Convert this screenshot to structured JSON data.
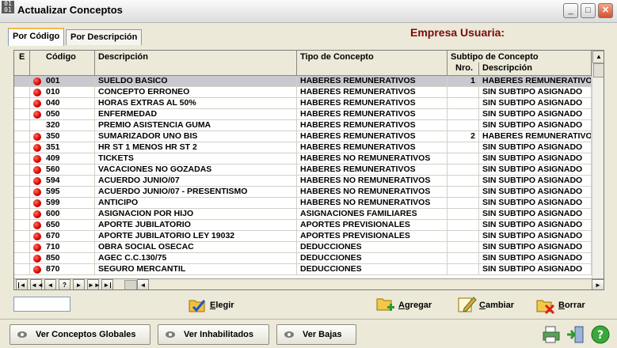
{
  "window": {
    "title": "Actualizar Conceptos",
    "app_icon_text": "01 01",
    "minimize_label": "_",
    "maximize_label": "□",
    "close_label": "✕"
  },
  "tabs": [
    {
      "label": "Por Código",
      "active": true
    },
    {
      "label": "Por Descripción",
      "active": false
    }
  ],
  "empresa_label": "Empresa Usuaria:",
  "grid": {
    "columns": {
      "e": "E",
      "codigo": "Código",
      "descripcion": "Descripción",
      "tipo": "Tipo de Concepto",
      "subtipo": "Subtipo de Concepto",
      "nro": "Nro.",
      "sub_descripcion": "Descripción"
    },
    "rows": [
      {
        "dot": true,
        "codigo": "001",
        "descripcion": "SUELDO BASICO",
        "tipo": "HABERES REMUNERATIVOS",
        "nro": "1",
        "sub": "HABERES REMUNERATIVOS",
        "selected": true
      },
      {
        "dot": true,
        "codigo": "010",
        "descripcion": "CONCEPTO ERRONEO",
        "tipo": "HABERES REMUNERATIVOS",
        "nro": "",
        "sub": "SIN SUBTIPO ASIGNADO"
      },
      {
        "dot": true,
        "codigo": "040",
        "descripcion": "HORAS EXTRAS AL 50%",
        "tipo": "HABERES REMUNERATIVOS",
        "nro": "",
        "sub": "SIN SUBTIPO ASIGNADO"
      },
      {
        "dot": true,
        "codigo": "050",
        "descripcion": "ENFERMEDAD",
        "tipo": "HABERES REMUNERATIVOS",
        "nro": "",
        "sub": "SIN SUBTIPO ASIGNADO"
      },
      {
        "dot": false,
        "codigo": "320",
        "descripcion": "PREMIO ASISTENCIA GUMA",
        "tipo": "HABERES REMUNERATIVOS",
        "nro": "",
        "sub": "SIN SUBTIPO ASIGNADO"
      },
      {
        "dot": true,
        "codigo": "350",
        "descripcion": "SUMARIZADOR UNO BIS",
        "tipo": "HABERES REMUNERATIVOS",
        "nro": "2",
        "sub": "HABERES REMUNERATIVOS"
      },
      {
        "dot": true,
        "codigo": "351",
        "descripcion": "HR ST 1 MENOS HR ST 2",
        "tipo": "HABERES REMUNERATIVOS",
        "nro": "",
        "sub": "SIN SUBTIPO ASIGNADO"
      },
      {
        "dot": true,
        "codigo": "409",
        "descripcion": "TICKETS",
        "tipo": "HABERES NO REMUNERATIVOS",
        "nro": "",
        "sub": "SIN SUBTIPO ASIGNADO"
      },
      {
        "dot": true,
        "codigo": "560",
        "descripcion": "VACACIONES NO GOZADAS",
        "tipo": "HABERES REMUNERATIVOS",
        "nro": "",
        "sub": "SIN SUBTIPO ASIGNADO"
      },
      {
        "dot": true,
        "codigo": "594",
        "descripcion": "ACUERDO JUNIO/07",
        "tipo": "HABERES NO REMUNERATIVOS",
        "nro": "",
        "sub": "SIN SUBTIPO ASIGNADO"
      },
      {
        "dot": true,
        "codigo": "595",
        "descripcion": "ACUERDO JUNIO/07 - PRESENTISMO",
        "tipo": "HABERES NO REMUNERATIVOS",
        "nro": "",
        "sub": "SIN SUBTIPO ASIGNADO"
      },
      {
        "dot": true,
        "codigo": "599",
        "descripcion": "ANTICIPO",
        "tipo": "HABERES NO REMUNERATIVOS",
        "nro": "",
        "sub": "SIN SUBTIPO ASIGNADO"
      },
      {
        "dot": true,
        "codigo": "600",
        "descripcion": "ASIGNACION POR HIJO",
        "tipo": "ASIGNACIONES FAMILIARES",
        "nro": "",
        "sub": "SIN SUBTIPO ASIGNADO"
      },
      {
        "dot": true,
        "codigo": "650",
        "descripcion": "APORTE JUBILATORIO",
        "tipo": "APORTES PREVISIONALES",
        "nro": "",
        "sub": "SIN SUBTIPO ASIGNADO"
      },
      {
        "dot": true,
        "codigo": "670",
        "descripcion": "APORTE JUBILATORIO LEY 19032",
        "tipo": "APORTES PREVISIONALES",
        "nro": "",
        "sub": "SIN SUBTIPO ASIGNADO"
      },
      {
        "dot": true,
        "codigo": "710",
        "descripcion": "OBRA SOCIAL OSECAC",
        "tipo": "DEDUCCIONES",
        "nro": "",
        "sub": "SIN SUBTIPO ASIGNADO"
      },
      {
        "dot": true,
        "codigo": "850",
        "descripcion": "AGEC C.C.130/75",
        "tipo": "DEDUCCIONES",
        "nro": "",
        "sub": "SIN SUBTIPO ASIGNADO"
      },
      {
        "dot": true,
        "codigo": "870",
        "descripcion": "SEGURO MERCANTIL",
        "tipo": "DEDUCCIONES",
        "nro": "",
        "sub": "SIN SUBTIPO ASIGNADO"
      }
    ],
    "nav_buttons": [
      "|◄",
      "◄◄",
      "◄",
      "?",
      "►",
      "►►",
      "►|"
    ]
  },
  "actions": {
    "elegir": "Elegir",
    "agregar": "Agregar",
    "cambiar": "Cambiar",
    "borrar": "Borrar"
  },
  "bottom_buttons": {
    "globales": "Ver Conceptos Globales",
    "inhabilitados": "Ver Inhabilitados",
    "bajas": "Ver Bajas"
  },
  "colors": {
    "empresa": "#7b0a0a",
    "dot": "#d40000",
    "selected_row": "#c9c8cf"
  }
}
